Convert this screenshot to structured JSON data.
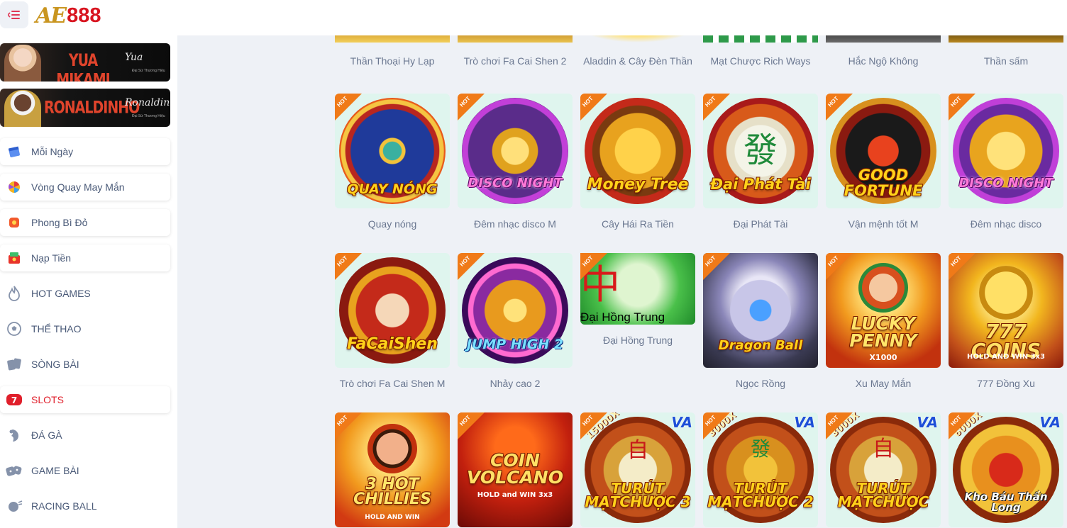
{
  "header": {
    "logo_ae": "AE",
    "logo_num": "888"
  },
  "sidebar": {
    "banners": [
      {
        "name": "YUA MIKAMI",
        "signature": "Yua",
        "caption": "Đại Sứ Thương Hiệu"
      },
      {
        "name": "RONALDINHO",
        "signature": "Ronaldinho",
        "caption": "Đại Sứ Thương Hiệu"
      }
    ],
    "items": [
      {
        "label": "Mỗi Ngày",
        "icon": "calendar-icon"
      },
      {
        "label": "Vòng Quay May Mắn",
        "icon": "lucky-wheel-icon"
      },
      {
        "label": "Phong Bì Đỏ",
        "icon": "red-envelope-icon"
      },
      {
        "label": "Nạp Tiền",
        "icon": "deposit-icon"
      },
      {
        "label": "HOT GAMES",
        "icon": "flame-icon"
      },
      {
        "label": "THỂ THAO",
        "icon": "soccer-ball-icon"
      },
      {
        "label": "SÒNG BÀI",
        "icon": "cards-icon"
      },
      {
        "label": "SLOTS",
        "icon": "slot-machine-icon"
      },
      {
        "label": "ĐÁ GÀ",
        "icon": "rooster-icon"
      },
      {
        "label": "GAME BÀI",
        "icon": "dice-icon"
      },
      {
        "label": "RACING BALL",
        "icon": "racing-ball-icon"
      }
    ],
    "active_item": "SLOTS",
    "colors": {
      "active": "#e01f2b",
      "text": "#4a5a78"
    }
  },
  "games": {
    "hot_badge": "HOT",
    "va_badge": "VA",
    "top_row": [
      {
        "name": "Thần Thoại Hy Lạp"
      },
      {
        "name": "Trò chơi Fa Cai Shen 2"
      },
      {
        "name": "Aladdin & Cây Đèn Thần"
      },
      {
        "name": "Mạt Chược Rich Ways"
      },
      {
        "name": "Hắc Ngộ Không"
      },
      {
        "name": "Thần sấm"
      }
    ],
    "row1": [
      {
        "name": "Quay nóng",
        "logo": "QUAY NÓNG",
        "art": "lucky-wheel"
      },
      {
        "name": "Đêm nhạc disco M",
        "logo": "DISCO NIGHT",
        "art": "diamond-phone"
      },
      {
        "name": "Cây Hái Ra Tiền",
        "logo": "Money Tree",
        "art": "golden-tree"
      },
      {
        "name": "Đại Phát Tài",
        "logo": "Đại Phát Tài",
        "art": "mahjong-tile"
      },
      {
        "name": "Vận mệnh tốt M",
        "logo": "GOOD FORTUNE",
        "art": "phone"
      },
      {
        "name": "Đêm nhạc disco",
        "logo": "DISCO NIGHT",
        "art": "diamond"
      }
    ],
    "row2": [
      {
        "name": "Trò chơi Fa Cai Shen M",
        "logo": "FaCaiShen",
        "art": "god-of-wealth"
      },
      {
        "name": "Nhảy cao 2",
        "logo": "JUMP HIGH 2",
        "art": "disco-ball"
      },
      {
        "name": "Đại Hồng Trung",
        "logo": "Đại Hồng Trung",
        "art": "red-dragon-tile"
      },
      {
        "name": "Ngọc Rồng",
        "logo": "Dragon Ball",
        "art": "dragon"
      },
      {
        "name": "Xu May Mắn",
        "logo": "LUCKY PENNY",
        "sub": "X1000",
        "art": "leprechaun"
      },
      {
        "name": "777 Đồng Xu",
        "logo": "777 COINS",
        "sub": "HOLD AND WIN 3x3",
        "art": "coins"
      }
    ],
    "row3": [
      {
        "logo": "3 HOT CHILLIES",
        "sub": "HOLD AND WIN",
        "art": "chili-man"
      },
      {
        "logo": "COIN VOLCANO",
        "sub": "HOLD and WIN 3x3",
        "art": "volcano"
      },
      {
        "logo": "TURÚT MẠTCHƯỢC 3",
        "mult": "15000X",
        "art": "mahjong"
      },
      {
        "logo": "TURÚT MẠTCHƯỢC 2",
        "mult": "3000X",
        "art": "mahjong-dragon"
      },
      {
        "logo": "TURÚT MẠTCHƯỢC",
        "mult": "3000X",
        "art": "mahjong"
      },
      {
        "logo": "Kho Báu Thần Long",
        "mult": "6000X",
        "art": "red-dragon"
      }
    ]
  }
}
